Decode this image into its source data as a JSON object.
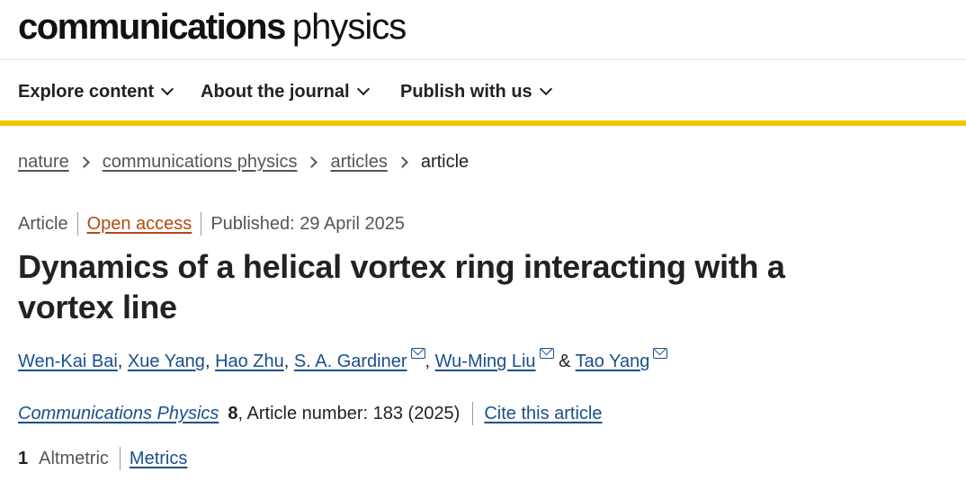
{
  "brand": {
    "bold": "communications",
    "light": "physics"
  },
  "nav": [
    {
      "label": "Explore content"
    },
    {
      "label": "About the journal"
    },
    {
      "label": "Publish with us"
    }
  ],
  "breadcrumb": [
    "nature",
    "communications physics",
    "articles",
    "article"
  ],
  "article": {
    "type": "Article",
    "access": "Open access",
    "published": "Published: 29 April 2025",
    "title": "Dynamics of a helical vortex ring interacting with a vortex line",
    "authors": [
      {
        "name": "Wen-Kai Bai",
        "email": false
      },
      {
        "name": "Xue Yang",
        "email": false
      },
      {
        "name": "Hao Zhu",
        "email": false
      },
      {
        "name": "S. A. Gardiner",
        "email": true
      },
      {
        "name": "Wu-Ming Liu",
        "email": true
      },
      {
        "name": "Tao Yang",
        "email": true
      }
    ],
    "journal": "Communications Physics",
    "volume": "8",
    "article_number": ", Article number: 183 (2025)",
    "cite_label": "Cite this article",
    "altmetric_count": "1",
    "altmetric_label": "Altmetric",
    "metrics_label": "Metrics"
  },
  "colors": {
    "accent_bar": "#f2c600",
    "link": "#1a4f8b",
    "open_access": "#b34a12"
  }
}
